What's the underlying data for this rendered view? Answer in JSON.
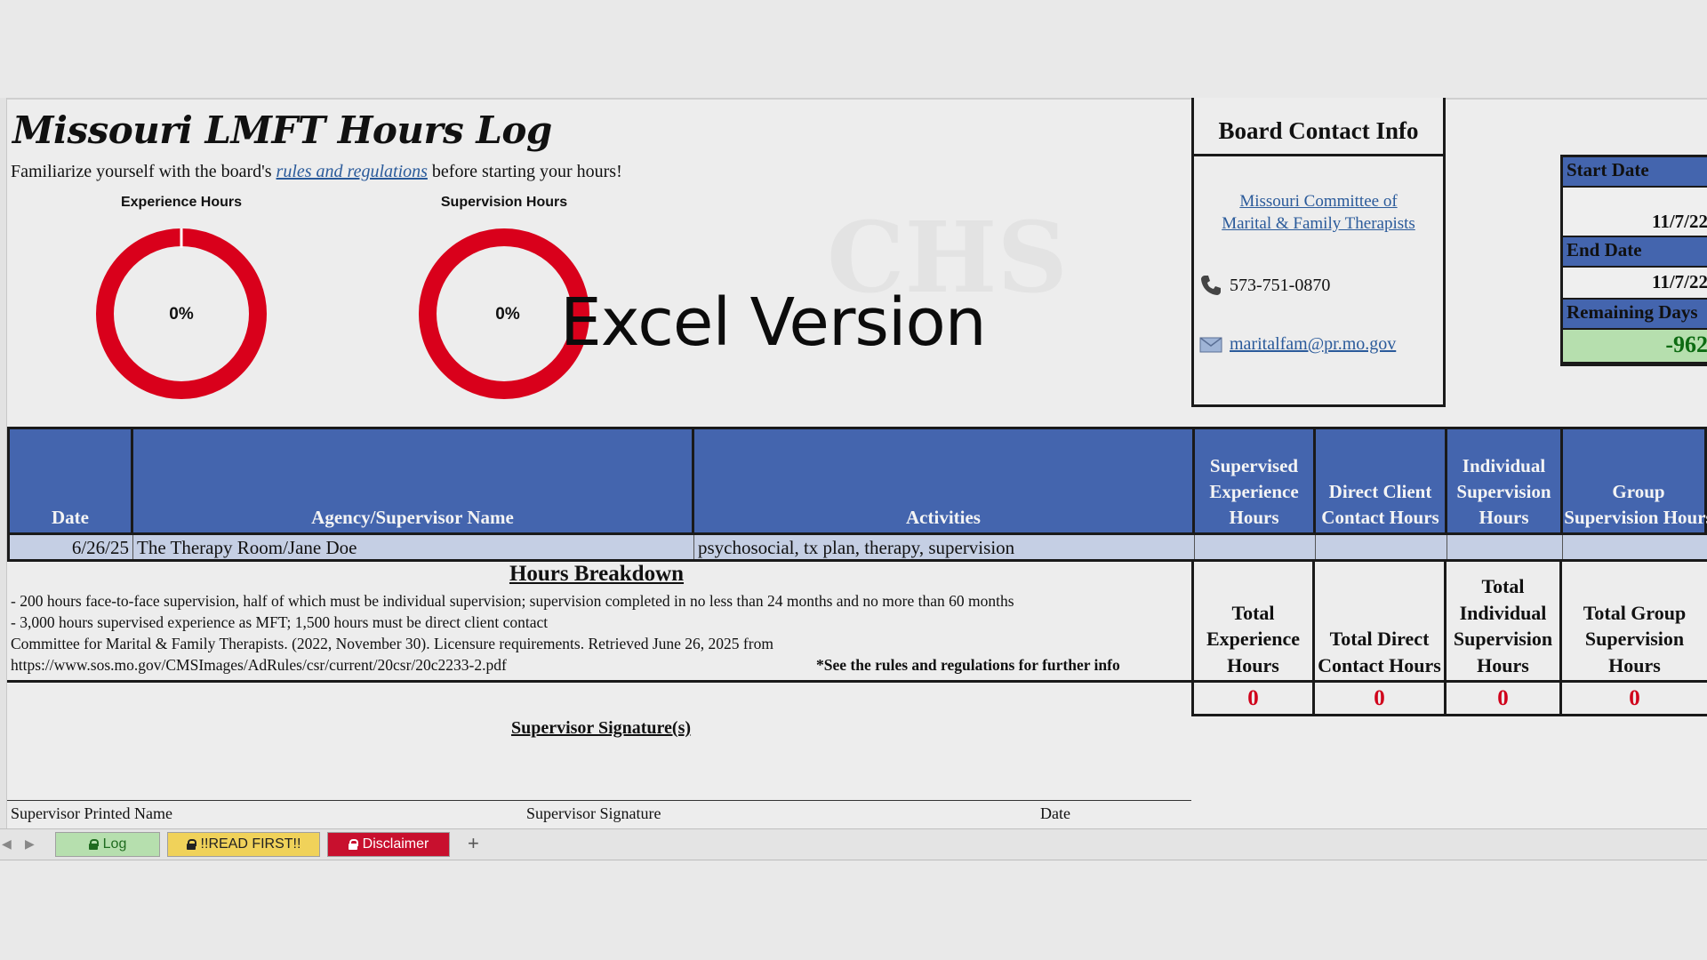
{
  "sheet": {
    "title": "Missouri LMFT Hours Log",
    "intro_before": "Familiarize yourself with the board's ",
    "intro_link": "rules and regulations",
    "intro_after": " before starting your hours!"
  },
  "charts": {
    "chart_data": [
      {
        "type": "pie",
        "title": "Experience Hours",
        "values": [
          0,
          100
        ],
        "center_label": "0%"
      },
      {
        "type": "pie",
        "title": "Supervision Hours",
        "values": [
          0,
          100
        ],
        "center_label": "0%"
      }
    ]
  },
  "overlay": {
    "text": "Excel Version"
  },
  "contact": {
    "header": "Board Contact Info",
    "org_line1": "Missouri Committee of",
    "org_line2": "Marital & Family Therapists",
    "phone": "573-751-0870",
    "email": "maritalfam@pr.mo.gov"
  },
  "dates": {
    "start_label": "Start Date",
    "start_value": "11/7/22",
    "end_label": "End Date",
    "end_value": "11/7/22",
    "remaining_label": "Remaining Days",
    "remaining_value": "-962"
  },
  "table": {
    "headers": {
      "date": "Date",
      "agency": "Agency/Supervisor Name",
      "activities": "Activities",
      "supervised": "Supervised Experience Hours",
      "direct": "Direct Client Contact Hours",
      "individual": "Individual Supervision Hours",
      "group": "Group Supervision Hours"
    },
    "rows": [
      {
        "date": "6/26/25",
        "agency": "The Therapy Room/Jane Doe",
        "activities": "psychosocial, tx plan, therapy, supervision"
      }
    ]
  },
  "breakdown": {
    "title": "Hours Breakdown",
    "line1": "- 200 hours face-to-face supervision, half of which must be individual supervision; supervision completed in no less than 24 months and no more than 60 months",
    "line2": "- 3,000 hours supervised experience as MFT; 1,500 hours must be direct client contact",
    "line3": "Committee for Marital & Family Therapists. (2022, November 30). Licensure requirements. Retrieved June 26, 2025 from",
    "line4": "https://www.sos.mo.gov/CMSImages/AdRules/csr/current/20csr/20c2233-2.pdf",
    "note": "*See the rules and regulations for further info"
  },
  "totals": {
    "experience_label": "Total Experience Hours",
    "direct_label": "Total Direct Contact Hours",
    "individual_label": "Total Individual Supervision Hours",
    "group_label": "Total Group Supervision Hours",
    "experience_value": "0",
    "direct_value": "0",
    "individual_value": "0",
    "group_value": "0"
  },
  "signature": {
    "title": "Supervisor Signature(s)",
    "printed_name": "Supervisor Printed Name",
    "signature": "Supervisor Signature",
    "date": "Date"
  },
  "tabs": [
    {
      "label": "Log",
      "color": "#b6dfae",
      "text_color": "#1f6b1f"
    },
    {
      "label": "!!READ FIRST!!",
      "color": "#f0d25a",
      "text_color": "#222222"
    },
    {
      "label": "Disclaimer",
      "color": "#c8102e",
      "text_color": "#ffffff"
    }
  ],
  "colors": {
    "accent_blue": "#4465ae",
    "chart_red": "#d9001b",
    "total_red": "#d0021b"
  }
}
